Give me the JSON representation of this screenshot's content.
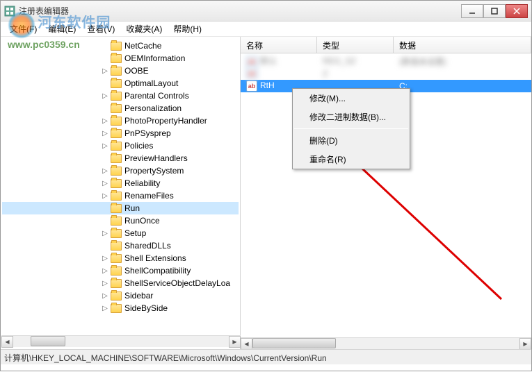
{
  "window": {
    "title": "注册表编辑器"
  },
  "watermark": {
    "text": "河东软件园",
    "url": "www.pc0359.cn"
  },
  "menu": {
    "file": "文件(F)",
    "edit": "编辑(E)",
    "view": "查看(V)",
    "favorites": "收藏夹(A)",
    "help": "帮助(H)"
  },
  "tree": {
    "items": [
      {
        "label": "NetCache",
        "indent": 140,
        "expander": ""
      },
      {
        "label": "OEMInformation",
        "indent": 140,
        "expander": ""
      },
      {
        "label": "OOBE",
        "indent": 140,
        "expander": "▷"
      },
      {
        "label": "OptimalLayout",
        "indent": 140,
        "expander": ""
      },
      {
        "label": "Parental Controls",
        "indent": 140,
        "expander": "▷"
      },
      {
        "label": "Personalization",
        "indent": 140,
        "expander": ""
      },
      {
        "label": "PhotoPropertyHandler",
        "indent": 140,
        "expander": "▷"
      },
      {
        "label": "PnPSysprep",
        "indent": 140,
        "expander": "▷"
      },
      {
        "label": "Policies",
        "indent": 140,
        "expander": "▷"
      },
      {
        "label": "PreviewHandlers",
        "indent": 140,
        "expander": ""
      },
      {
        "label": "PropertySystem",
        "indent": 140,
        "expander": "▷"
      },
      {
        "label": "Reliability",
        "indent": 140,
        "expander": "▷"
      },
      {
        "label": "RenameFiles",
        "indent": 140,
        "expander": "▷"
      },
      {
        "label": "Run",
        "indent": 140,
        "expander": "",
        "selected": true
      },
      {
        "label": "RunOnce",
        "indent": 140,
        "expander": ""
      },
      {
        "label": "Setup",
        "indent": 140,
        "expander": "▷"
      },
      {
        "label": "SharedDLLs",
        "indent": 140,
        "expander": ""
      },
      {
        "label": "Shell Extensions",
        "indent": 140,
        "expander": "▷"
      },
      {
        "label": "ShellCompatibility",
        "indent": 140,
        "expander": "▷"
      },
      {
        "label": "ShellServiceObjectDelayLoa",
        "indent": 140,
        "expander": "▷"
      },
      {
        "label": "Sidebar",
        "indent": 140,
        "expander": "▷"
      },
      {
        "label": "SideBySide",
        "indent": 140,
        "expander": "▷"
      }
    ]
  },
  "list": {
    "header": {
      "name": "名称",
      "type": "类型",
      "data": "数据"
    },
    "rows": [
      {
        "name": "默认",
        "type": "REG_SZ",
        "data": "(数值未设置)",
        "blur": true
      },
      {
        "name": "",
        "type": "Z",
        "data": "",
        "blur": true
      },
      {
        "name": "RtH",
        "type": "",
        "data": "C:",
        "selected": true
      }
    ]
  },
  "context_menu": {
    "modify": "修改(M)...",
    "modify_binary": "修改二进制数据(B)...",
    "delete": "删除(D)",
    "rename": "重命名(R)"
  },
  "statusbar": {
    "path": "计算机\\HKEY_LOCAL_MACHINE\\SOFTWARE\\Microsoft\\Windows\\CurrentVersion\\Run"
  }
}
